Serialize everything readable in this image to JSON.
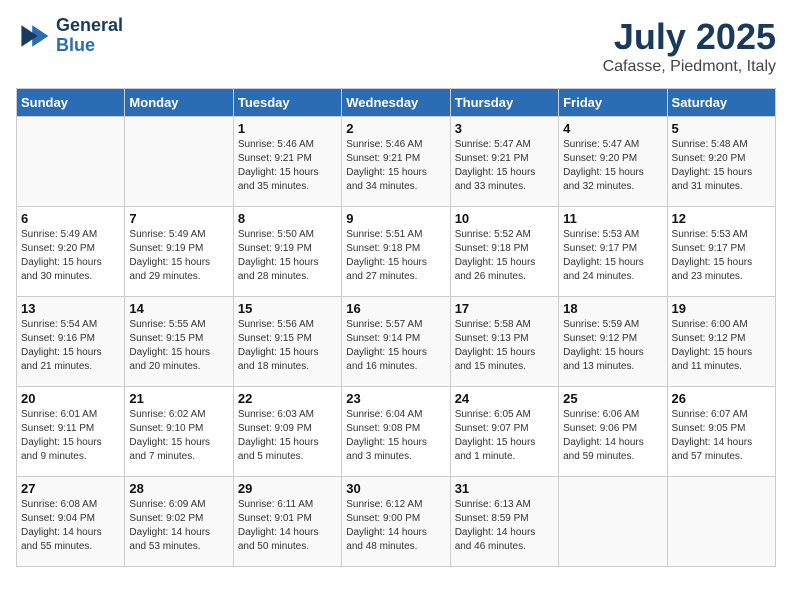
{
  "logo": {
    "line1": "General",
    "line2": "Blue"
  },
  "title": "July 2025",
  "subtitle": "Cafasse, Piedmont, Italy",
  "days_of_week": [
    "Sunday",
    "Monday",
    "Tuesday",
    "Wednesday",
    "Thursday",
    "Friday",
    "Saturday"
  ],
  "weeks": [
    [
      {
        "num": "",
        "info": ""
      },
      {
        "num": "",
        "info": ""
      },
      {
        "num": "1",
        "info": "Sunrise: 5:46 AM\nSunset: 9:21 PM\nDaylight: 15 hours\nand 35 minutes."
      },
      {
        "num": "2",
        "info": "Sunrise: 5:46 AM\nSunset: 9:21 PM\nDaylight: 15 hours\nand 34 minutes."
      },
      {
        "num": "3",
        "info": "Sunrise: 5:47 AM\nSunset: 9:21 PM\nDaylight: 15 hours\nand 33 minutes."
      },
      {
        "num": "4",
        "info": "Sunrise: 5:47 AM\nSunset: 9:20 PM\nDaylight: 15 hours\nand 32 minutes."
      },
      {
        "num": "5",
        "info": "Sunrise: 5:48 AM\nSunset: 9:20 PM\nDaylight: 15 hours\nand 31 minutes."
      }
    ],
    [
      {
        "num": "6",
        "info": "Sunrise: 5:49 AM\nSunset: 9:20 PM\nDaylight: 15 hours\nand 30 minutes."
      },
      {
        "num": "7",
        "info": "Sunrise: 5:49 AM\nSunset: 9:19 PM\nDaylight: 15 hours\nand 29 minutes."
      },
      {
        "num": "8",
        "info": "Sunrise: 5:50 AM\nSunset: 9:19 PM\nDaylight: 15 hours\nand 28 minutes."
      },
      {
        "num": "9",
        "info": "Sunrise: 5:51 AM\nSunset: 9:18 PM\nDaylight: 15 hours\nand 27 minutes."
      },
      {
        "num": "10",
        "info": "Sunrise: 5:52 AM\nSunset: 9:18 PM\nDaylight: 15 hours\nand 26 minutes."
      },
      {
        "num": "11",
        "info": "Sunrise: 5:53 AM\nSunset: 9:17 PM\nDaylight: 15 hours\nand 24 minutes."
      },
      {
        "num": "12",
        "info": "Sunrise: 5:53 AM\nSunset: 9:17 PM\nDaylight: 15 hours\nand 23 minutes."
      }
    ],
    [
      {
        "num": "13",
        "info": "Sunrise: 5:54 AM\nSunset: 9:16 PM\nDaylight: 15 hours\nand 21 minutes."
      },
      {
        "num": "14",
        "info": "Sunrise: 5:55 AM\nSunset: 9:15 PM\nDaylight: 15 hours\nand 20 minutes."
      },
      {
        "num": "15",
        "info": "Sunrise: 5:56 AM\nSunset: 9:15 PM\nDaylight: 15 hours\nand 18 minutes."
      },
      {
        "num": "16",
        "info": "Sunrise: 5:57 AM\nSunset: 9:14 PM\nDaylight: 15 hours\nand 16 minutes."
      },
      {
        "num": "17",
        "info": "Sunrise: 5:58 AM\nSunset: 9:13 PM\nDaylight: 15 hours\nand 15 minutes."
      },
      {
        "num": "18",
        "info": "Sunrise: 5:59 AM\nSunset: 9:12 PM\nDaylight: 15 hours\nand 13 minutes."
      },
      {
        "num": "19",
        "info": "Sunrise: 6:00 AM\nSunset: 9:12 PM\nDaylight: 15 hours\nand 11 minutes."
      }
    ],
    [
      {
        "num": "20",
        "info": "Sunrise: 6:01 AM\nSunset: 9:11 PM\nDaylight: 15 hours\nand 9 minutes."
      },
      {
        "num": "21",
        "info": "Sunrise: 6:02 AM\nSunset: 9:10 PM\nDaylight: 15 hours\nand 7 minutes."
      },
      {
        "num": "22",
        "info": "Sunrise: 6:03 AM\nSunset: 9:09 PM\nDaylight: 15 hours\nand 5 minutes."
      },
      {
        "num": "23",
        "info": "Sunrise: 6:04 AM\nSunset: 9:08 PM\nDaylight: 15 hours\nand 3 minutes."
      },
      {
        "num": "24",
        "info": "Sunrise: 6:05 AM\nSunset: 9:07 PM\nDaylight: 15 hours\nand 1 minute."
      },
      {
        "num": "25",
        "info": "Sunrise: 6:06 AM\nSunset: 9:06 PM\nDaylight: 14 hours\nand 59 minutes."
      },
      {
        "num": "26",
        "info": "Sunrise: 6:07 AM\nSunset: 9:05 PM\nDaylight: 14 hours\nand 57 minutes."
      }
    ],
    [
      {
        "num": "27",
        "info": "Sunrise: 6:08 AM\nSunset: 9:04 PM\nDaylight: 14 hours\nand 55 minutes."
      },
      {
        "num": "28",
        "info": "Sunrise: 6:09 AM\nSunset: 9:02 PM\nDaylight: 14 hours\nand 53 minutes."
      },
      {
        "num": "29",
        "info": "Sunrise: 6:11 AM\nSunset: 9:01 PM\nDaylight: 14 hours\nand 50 minutes."
      },
      {
        "num": "30",
        "info": "Sunrise: 6:12 AM\nSunset: 9:00 PM\nDaylight: 14 hours\nand 48 minutes."
      },
      {
        "num": "31",
        "info": "Sunrise: 6:13 AM\nSunset: 8:59 PM\nDaylight: 14 hours\nand 46 minutes."
      },
      {
        "num": "",
        "info": ""
      },
      {
        "num": "",
        "info": ""
      }
    ]
  ]
}
